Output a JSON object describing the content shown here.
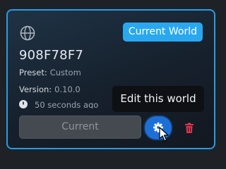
{
  "card": {
    "badge_label": "Current World",
    "world_id": "908F78F7",
    "preset_label": "Preset:",
    "preset_value": "Custom",
    "version_label": "Version:",
    "version_value": "0.10.0",
    "last_played": "50 seconds ago",
    "current_button_label": "Current",
    "settings_icon": "gear-icon",
    "delete_icon": "trash-icon",
    "globe_icon": "globe-icon"
  },
  "tooltip": {
    "text": "Edit this world"
  },
  "colors": {
    "accent": "#2b9be0",
    "badge": "#29a8f0",
    "settings_button": "#1d6fd8",
    "delete": "#e0344a"
  }
}
